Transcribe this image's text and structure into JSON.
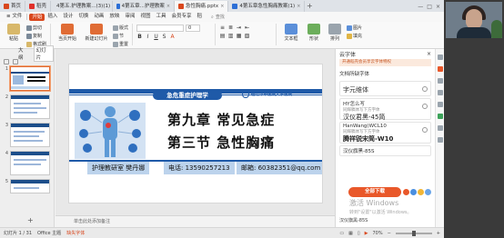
{
  "tabs": [
    {
      "label": "首页",
      "color": "#d9471d",
      "active": false
    },
    {
      "label": "稻壳",
      "color": "#e0302a",
      "active": false
    },
    {
      "label": "4第五.护理教案...(3)(1)",
      "color": "#2c6fd6",
      "active": false
    },
    {
      "label": "4第五章...护理教案",
      "color": "#2c6fd6",
      "active": false
    },
    {
      "label": "急性胸痛.pptx",
      "color": "#d9471d",
      "active": true
    },
    {
      "label": "4第五章急性胸痛教案(1)",
      "color": "#2c6fd6",
      "active": false
    }
  ],
  "titlebar_right": [
    "—",
    "□",
    "×"
  ],
  "menu": {
    "file": "≡ 文件",
    "items": [
      "开始",
      "插入",
      "设计",
      "切换",
      "动画",
      "放映",
      "审阅",
      "视图",
      "工具",
      "会员专享",
      "稻"
    ],
    "search": "查找"
  },
  "ribbon": {
    "paste": "粘贴",
    "format_painter": "格式刷",
    "cut": "剪切",
    "copy": "复制",
    "from_current": "当页开始",
    "new_slide": "新建幻灯片",
    "layout": "版式",
    "section": "节",
    "reset": "重置",
    "font_name": "",
    "font_size": "0",
    "text_box": "文本框",
    "shape": "形状",
    "arrange": "排列",
    "picture": "图片",
    "fill": "填充"
  },
  "leftpane": {
    "tab_outline": "大纲",
    "tab_slides": "幻灯片",
    "slide_numbers": [
      "1",
      "2",
      "3",
      "4",
      "5"
    ],
    "add_icon": "+"
  },
  "slide": {
    "banner": "急危重症护理学",
    "logo_text": "宿迁市中医院大学医院",
    "title1": "第九章  常见急症",
    "title2": "第三节  急性胸痛",
    "info": [
      "护理教研室  樊丹娜",
      "电话: 13590257213",
      "邮箱: 60382351@qq.com"
    ]
  },
  "notes_placeholder": "单击此处添加备注",
  "rightpane": {
    "title": "云字体",
    "close": "×",
    "promo": "开通稻壳会员享云字体特权",
    "section": "文档所缺字体",
    "fonts": [
      {
        "name": "字元维体",
        "sub": "",
        "preview": ""
      },
      {
        "name": "HY怎么写",
        "sub": "同辉稿体写下方字体",
        "preview": "汉仪君黑-45简"
      },
      {
        "name": "HanWang(WCL10",
        "sub": "同辉稿体写下方字体",
        "preview": "腾祥锐宋简-W10"
      },
      {
        "name": "汉仪旗黑-85S",
        "sub": "",
        "preview": ""
      }
    ],
    "download_all": "全部下载",
    "bottom": "汉仪旗黑-85S"
  },
  "statusbar": {
    "page": "幻灯片 1 / 31",
    "theme": "Office 主题",
    "missing_font": "缺失字体",
    "zoom": "70%"
  },
  "watermark": {
    "line1": "激活 Windows",
    "line2": "转到\"设置\"以激活 Windows。"
  }
}
